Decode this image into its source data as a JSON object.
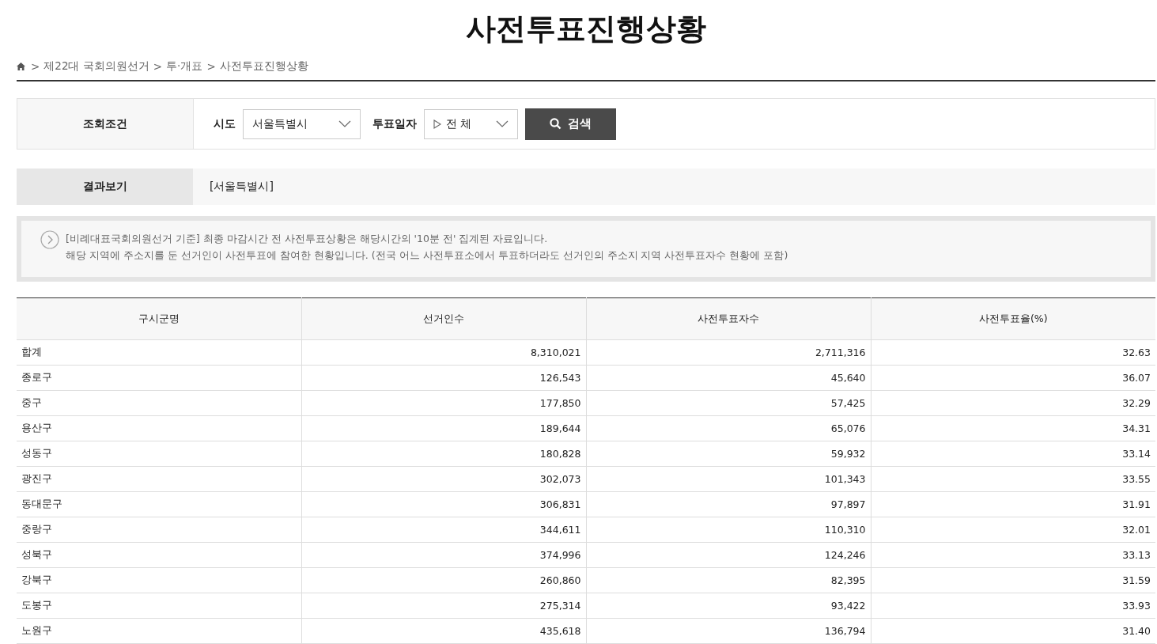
{
  "title": "사전투표진행상황",
  "breadcrumb": [
    {
      "separator": ">",
      "label": "제22대 국회의원선거"
    },
    {
      "separator": ">",
      "label": "투·개표"
    },
    {
      "separator": ">",
      "label": "사전투표진행상황"
    }
  ],
  "search": {
    "heading": "조회조건",
    "region_label": "시도",
    "region_value": "서울특별시",
    "date_label": "투표일자",
    "date_value": "전 체",
    "button": "검색"
  },
  "result": {
    "heading": "결과보기",
    "value": "[서울특별시]"
  },
  "notice": [
    "[비례대표국회의원선거 기준] 최종 마감시간 전 사전투표상황은 해당시간의 '10분 전' 집계된 자료입니다.",
    "해당 지역에 주소지를 둔 선거인이 사전투표에 참여한 현황입니다. (전국 어느 사전투표소에서 투표하더라도 선거인의 주소지 지역 사전투표자수 현황에 포함)"
  ],
  "table": {
    "columns": [
      "구시군명",
      "선거인수",
      "사전투표자수",
      "사전투표율(%)"
    ],
    "rows": [
      [
        "합계",
        "8,310,021",
        "2,711,316",
        "32.63"
      ],
      [
        "종로구",
        "126,543",
        "45,640",
        "36.07"
      ],
      [
        "중구",
        "177,850",
        "57,425",
        "32.29"
      ],
      [
        "용산구",
        "189,644",
        "65,076",
        "34.31"
      ],
      [
        "성동구",
        "180,828",
        "59,932",
        "33.14"
      ],
      [
        "광진구",
        "302,073",
        "101,343",
        "33.55"
      ],
      [
        "동대문구",
        "306,831",
        "97,897",
        "31.91"
      ],
      [
        "중랑구",
        "344,611",
        "110,310",
        "32.01"
      ],
      [
        "성북구",
        "374,996",
        "124,246",
        "33.13"
      ],
      [
        "강북구",
        "260,860",
        "82,395",
        "31.59"
      ],
      [
        "도봉구",
        "275,314",
        "93,422",
        "33.93"
      ],
      [
        "노원구",
        "435,618",
        "136,794",
        "31.40"
      ]
    ]
  }
}
